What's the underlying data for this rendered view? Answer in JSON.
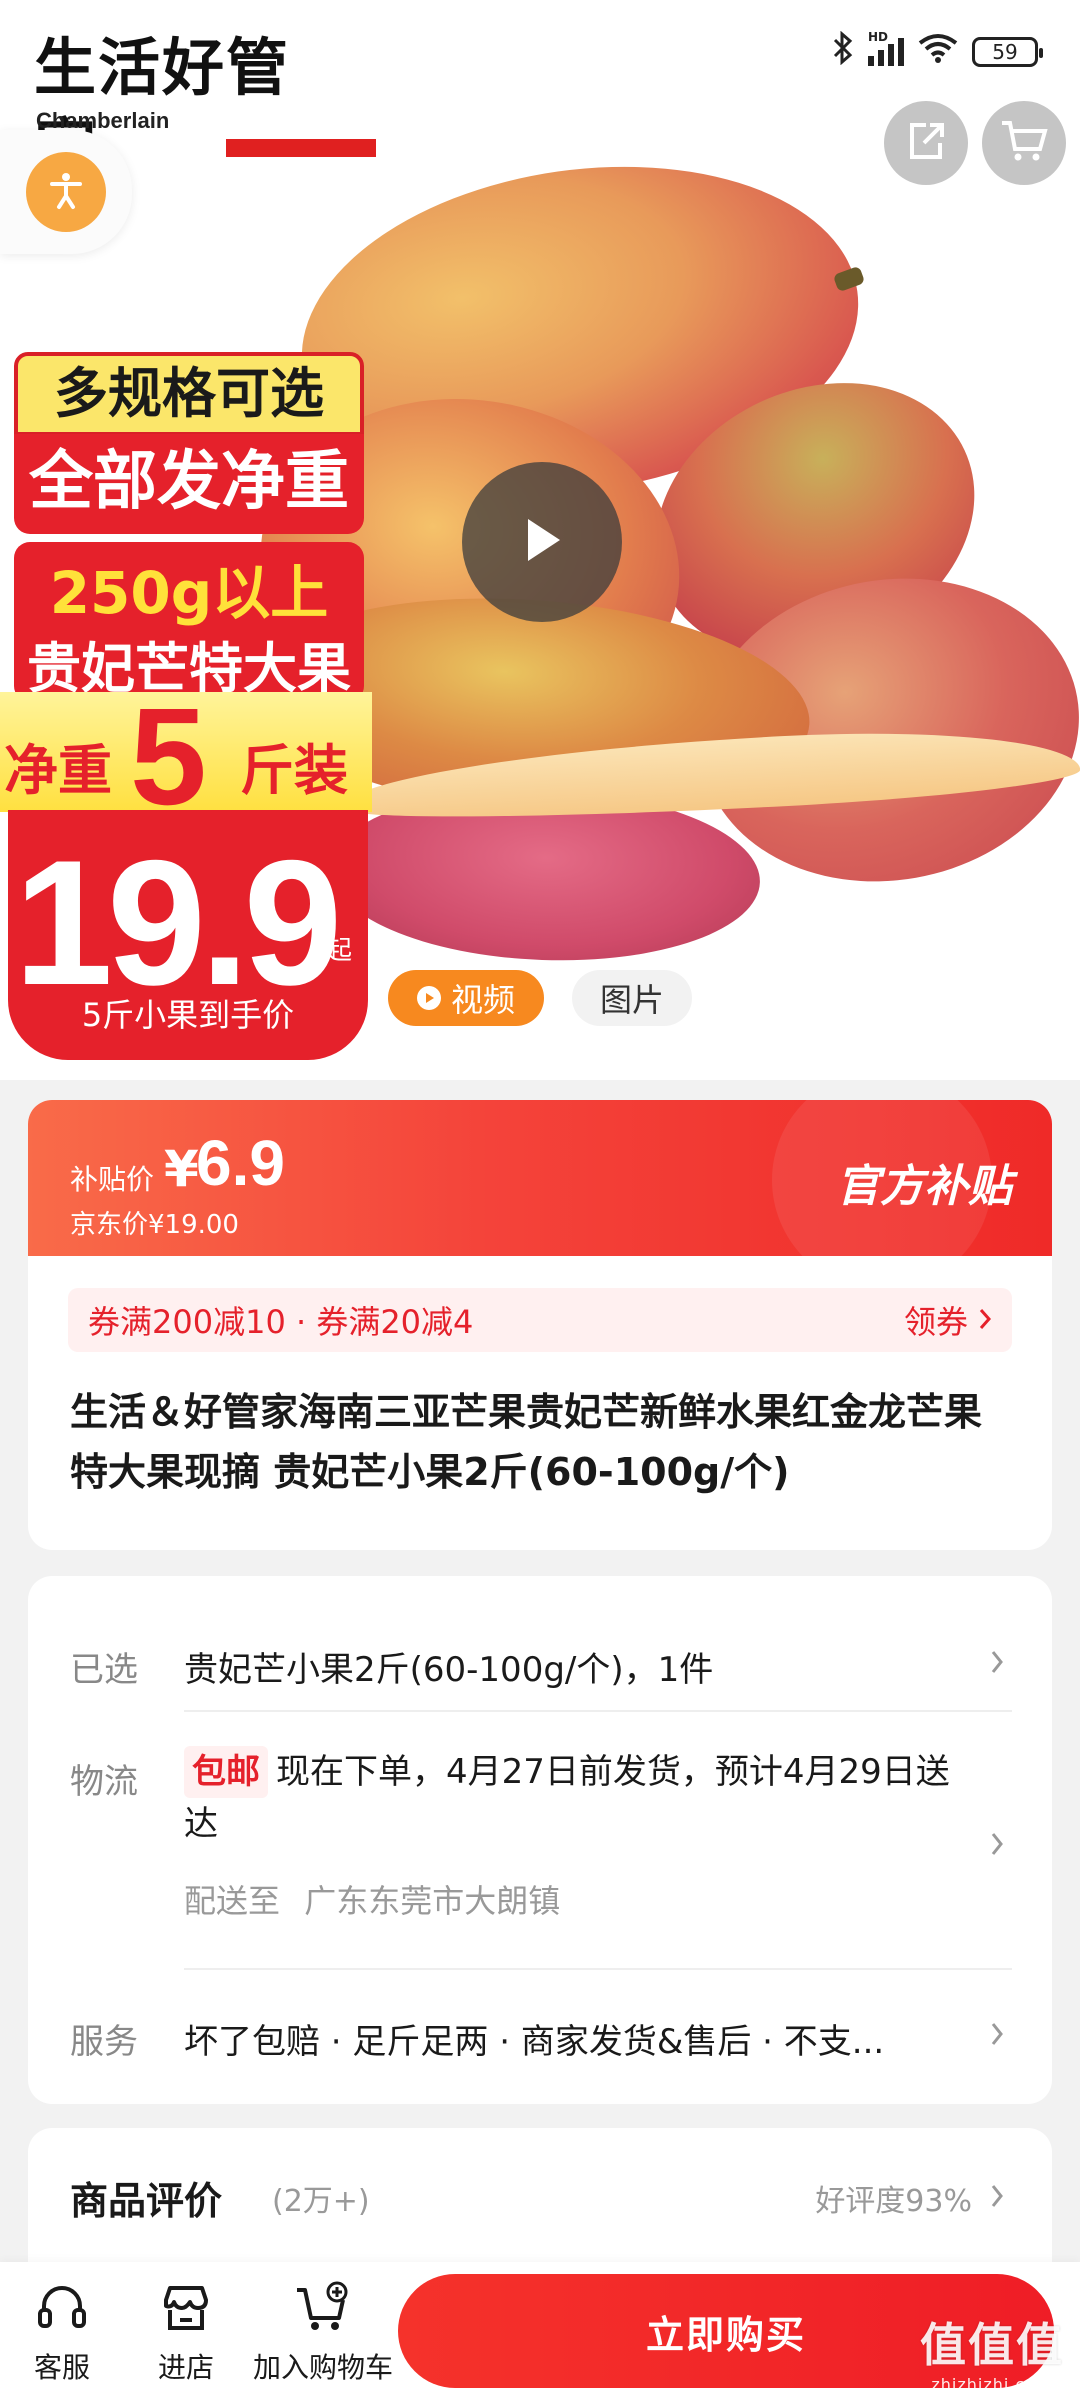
{
  "hero": {
    "brand_logo_cn": "生活好管家",
    "brand_logo_en": "Chamberlain",
    "status": {
      "battery": "59"
    },
    "promo": {
      "line1": "多规格可选",
      "line2": "全部发净重",
      "line3": "250g以上",
      "line4": "贵妃芒特大果",
      "net_left": "净重",
      "net_num": "5",
      "net_right": "斤装",
      "price": "19.9",
      "price_suffix": "起",
      "price_note": "5斤小果到手价"
    },
    "tabs": {
      "video": "视频",
      "image": "图片"
    }
  },
  "price_card": {
    "subsidy_label": "补贴价",
    "currency": "¥",
    "subsidy_price": "6.9",
    "jd_price": "京东价¥19.00",
    "official_badge": "官方补贴",
    "coupons": "券满200减10 · 券满20减4",
    "get_coupon": "领券",
    "title": "生活＆好管家海南三亚芒果贵妃芒新鲜水果红金龙芒果特大果现摘 贵妃芒小果2斤(60-100g/个)"
  },
  "info": {
    "selected_label": "已选",
    "selected_value": "贵妃芒小果2斤(60-100g/个)，1件",
    "logistics_label": "物流",
    "free_shipping": "包邮",
    "logistics_value": "现在下单，4月27日前发货，预计4月29日送达",
    "ship_to_label": "配送至",
    "ship_to_value": "广东东莞市大朗镇",
    "service_label": "服务",
    "service_value": "坏了包赔 · 足斤足两 · 商家发货&售后 · 不支..."
  },
  "review": {
    "title": "商品评价",
    "count": "(2万+)",
    "rate": "好评度93%"
  },
  "bottom": {
    "customer_service": "客服",
    "shop": "进店",
    "add_cart": "加入购物车",
    "buy_now": "立即购买",
    "watermark": "值值值",
    "watermark_url": "zhizhizhi.com"
  },
  "colors": {
    "accent_red": "#e5212b",
    "orange": "#f7891f",
    "subsidy_gradient_start": "#f96b49"
  },
  "icons": [
    "bluetooth-icon",
    "signal-icon",
    "wifi-icon",
    "battery-icon",
    "share-icon",
    "cart-icon",
    "accessibility-icon",
    "play-icon",
    "chevron-right-icon",
    "headset-icon",
    "store-icon",
    "add-cart-icon"
  ]
}
